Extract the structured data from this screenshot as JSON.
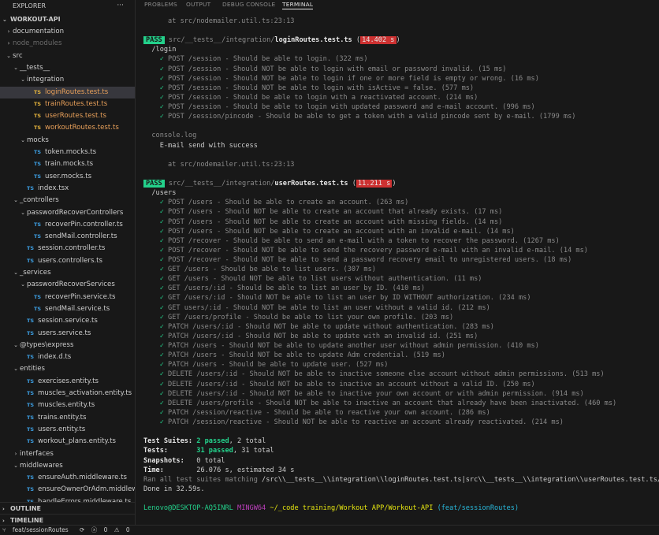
{
  "sidebar": {
    "title": "EXPLORER",
    "more": "···",
    "project": "WORKOUT-API",
    "outline": "OUTLINE",
    "timeline": "TIMELINE",
    "tree": [
      {
        "label": "documentation",
        "type": "folder",
        "open": false,
        "depth": 1
      },
      {
        "label": "node_modules",
        "type": "folder",
        "open": false,
        "depth": 1,
        "dim": true
      },
      {
        "label": "src",
        "type": "folder",
        "open": true,
        "depth": 1
      },
      {
        "label": "__tests__",
        "type": "folder",
        "open": true,
        "depth": 2
      },
      {
        "label": "integration",
        "type": "folder",
        "open": true,
        "depth": 3
      },
      {
        "label": "loginRoutes.test.ts",
        "type": "test",
        "depth": 4,
        "active": true
      },
      {
        "label": "trainRoutes.test.ts",
        "type": "test",
        "depth": 4
      },
      {
        "label": "userRoutes.test.ts",
        "type": "test",
        "depth": 4
      },
      {
        "label": "workoutRoutes.test.ts",
        "type": "test",
        "depth": 4
      },
      {
        "label": "mocks",
        "type": "folder",
        "open": true,
        "depth": 3
      },
      {
        "label": "token.mocks.ts",
        "type": "ts",
        "depth": 4
      },
      {
        "label": "train.mocks.ts",
        "type": "ts",
        "depth": 4
      },
      {
        "label": "user.mocks.ts",
        "type": "ts",
        "depth": 4
      },
      {
        "label": "index.tsx",
        "type": "ts",
        "depth": 3
      },
      {
        "label": "_controllers",
        "type": "folder",
        "open": true,
        "depth": 2
      },
      {
        "label": "passwordRecoverControllers",
        "type": "folder",
        "open": true,
        "depth": 3
      },
      {
        "label": "recoverPin.controller.ts",
        "type": "ts",
        "depth": 4
      },
      {
        "label": "sendMail.controller.ts",
        "type": "ts",
        "depth": 4
      },
      {
        "label": "session.controller.ts",
        "type": "ts",
        "depth": 3
      },
      {
        "label": "users.controllers.ts",
        "type": "ts",
        "depth": 3
      },
      {
        "label": "_services",
        "type": "folder",
        "open": true,
        "depth": 2
      },
      {
        "label": "passwordRecoverServices",
        "type": "folder",
        "open": true,
        "depth": 3
      },
      {
        "label": "recoverPin.service.ts",
        "type": "ts",
        "depth": 4
      },
      {
        "label": "sendMail.service.ts",
        "type": "ts",
        "depth": 4
      },
      {
        "label": "session.service.ts",
        "type": "ts",
        "depth": 3
      },
      {
        "label": "users.service.ts",
        "type": "ts",
        "depth": 3
      },
      {
        "label": "@types\\express",
        "type": "folder",
        "open": true,
        "depth": 2
      },
      {
        "label": "index.d.ts",
        "type": "ts",
        "depth": 3
      },
      {
        "label": "entities",
        "type": "folder",
        "open": true,
        "depth": 2
      },
      {
        "label": "exercises.entity.ts",
        "type": "ts",
        "depth": 3
      },
      {
        "label": "muscles_activation.entity.ts",
        "type": "ts",
        "depth": 3
      },
      {
        "label": "muscles.entity.ts",
        "type": "ts",
        "depth": 3
      },
      {
        "label": "trains.entity.ts",
        "type": "ts",
        "depth": 3
      },
      {
        "label": "users.entity.ts",
        "type": "ts",
        "depth": 3
      },
      {
        "label": "workout_plans.entity.ts",
        "type": "ts",
        "depth": 3
      },
      {
        "label": "interfaces",
        "type": "folder",
        "open": false,
        "depth": 2
      },
      {
        "label": "middlewares",
        "type": "folder",
        "open": true,
        "depth": 2
      },
      {
        "label": "ensureAuth.middleware.ts",
        "type": "ts",
        "depth": 3
      },
      {
        "label": "ensureOwnerOrAdm.middlewa...",
        "type": "ts",
        "depth": 3
      },
      {
        "label": "handleErrors.middleware.ts",
        "type": "ts",
        "depth": 3
      }
    ]
  },
  "panel": {
    "tabs": [
      {
        "label": "PROBLEMS",
        "active": false
      },
      {
        "label": "OUTPUT",
        "active": false
      },
      {
        "label": "DEBUG CONSOLE",
        "active": false
      },
      {
        "label": "TERMINAL",
        "active": true
      }
    ]
  },
  "terminal": {
    "lines": [
      {
        "kind": "at",
        "text": "      at src/nodemailer.util.ts:23:13"
      },
      {
        "kind": "blank"
      },
      {
        "kind": "suite",
        "badge": "PASS",
        "dir": "src/__tests__/integration/",
        "file": "loginRoutes.test.ts",
        "time": "14.402 s"
      },
      {
        "kind": "route",
        "text": "  /login"
      },
      {
        "kind": "test",
        "text": "POST /session - Should be able to login. (322 ms)"
      },
      {
        "kind": "test",
        "text": "POST /session - Should NOT be able to login with email or password invalid. (15 ms)"
      },
      {
        "kind": "test",
        "text": "POST /session - Should NOT be able to login if one or more field is empty or wrong. (16 ms)"
      },
      {
        "kind": "test",
        "text": "POST /session - Should NOT be able to login with isActive = false. (577 ms)"
      },
      {
        "kind": "test",
        "text": "POST /session - Should be able to login with a reactivated account. (214 ms)"
      },
      {
        "kind": "test",
        "text": "POST /session - Should be able to login with updated password and e-mail account. (996 ms)"
      },
      {
        "kind": "test",
        "text": "POST /session/pincode - Should be able to get a token with a valid pincode sent by e-mail. (1799 ms)"
      },
      {
        "kind": "blank"
      },
      {
        "kind": "console",
        "text": "  console.log"
      },
      {
        "kind": "plain",
        "text": "    E-mail send with success"
      },
      {
        "kind": "blank"
      },
      {
        "kind": "at",
        "text": "      at src/nodemailer.util.ts:23:13"
      },
      {
        "kind": "blank"
      },
      {
        "kind": "suite",
        "badge": "PASS",
        "dir": "src/__tests__/integration/",
        "file": "userRoutes.test.ts",
        "time": "11.211 s"
      },
      {
        "kind": "route",
        "text": "  /users"
      },
      {
        "kind": "test",
        "text": "POST /users - Should be able to create an account. (263 ms)"
      },
      {
        "kind": "test",
        "text": "POST /users - Should NOT be able to create an account that already exists. (17 ms)"
      },
      {
        "kind": "test",
        "text": "POST /users - Should NOT be able to create an account with missing fields. (14 ms)"
      },
      {
        "kind": "test",
        "text": "POST /users - Should NOT be able to create an account with an invalid e-mail. (14 ms)"
      },
      {
        "kind": "test",
        "text": "POST /recover - Should be able to send an e-mail with a token to recover the password. (1267 ms)"
      },
      {
        "kind": "test",
        "text": "POST /recover - Should NOT be able to send the recovery password e-mail with an invalid e-mail. (14 ms)"
      },
      {
        "kind": "test",
        "text": "POST /recover - Should NOT be able to send a password recovery email to unregistered users. (18 ms)"
      },
      {
        "kind": "test",
        "text": "GET /users - Should be able to list users. (307 ms)"
      },
      {
        "kind": "test",
        "text": "GET /users - Should NOT be able to list users without authentication. (11 ms)"
      },
      {
        "kind": "test",
        "text": "GET /users/:id - Should be able to list an user by ID. (410 ms)"
      },
      {
        "kind": "test",
        "text": "GET /users/:id - Should NOT be able to list an user by ID WITHOUT authorization. (234 ms)"
      },
      {
        "kind": "test",
        "text": "GET users/:id - Should NOT be able to list an user without a valid id. (212 ms)"
      },
      {
        "kind": "test",
        "text": "GET /users/profile - Should be able to list your own profile. (203 ms)"
      },
      {
        "kind": "test",
        "text": "PATCH /users/:id - Should NOT be able to update without authentication. (283 ms)"
      },
      {
        "kind": "test",
        "text": "PATCH /users/:id - Should NOT be able to update with an invalid id. (251 ms)"
      },
      {
        "kind": "test",
        "text": "PATCH /users - Should NOT be able to update another user without admin permission. (410 ms)"
      },
      {
        "kind": "test",
        "text": "PATCH /users - Should NOT be able to update Adm credential. (519 ms)"
      },
      {
        "kind": "test",
        "text": "PATCH /users - Should be able to update user. (527 ms)"
      },
      {
        "kind": "test",
        "text": "DELETE /users/:id - Should NOT be able to inactive someone else account without admin permissions. (513 ms)"
      },
      {
        "kind": "test",
        "text": "DELETE /users/:id - Should NOT be able to inactive an account without a valid ID. (250 ms)"
      },
      {
        "kind": "test",
        "text": "DELETE /users/:id - Should NOT be able to inactive your own account or with admin permission. (914 ms)"
      },
      {
        "kind": "test",
        "text": "DELETE /users/profile - Should NOT be able to inactive an account that already have been inactivated. (460 ms)"
      },
      {
        "kind": "test",
        "text": "PATCH /session/reactive - Should be able to reactive your own account. (286 ms)"
      },
      {
        "kind": "test",
        "text": "PATCH /session/reactive - Should NOT be able to reactive an account already reactivated. (214 ms)"
      },
      {
        "kind": "blank"
      },
      {
        "kind": "summary",
        "label": "Test Suites: ",
        "value": "2 passed",
        "rest": ", 2 total"
      },
      {
        "kind": "summary",
        "label": "Tests:       ",
        "value": "31 passed",
        "rest": ", 31 total"
      },
      {
        "kind": "summary",
        "label": "Snapshots:   ",
        "value": "",
        "rest": "0 total"
      },
      {
        "kind": "summary",
        "label": "Time:        ",
        "value": "",
        "rest": "26.076 s, estimated 34 s"
      },
      {
        "kind": "ranall",
        "pre": "Ran all test suites matching ",
        "path": "/src\\\\__tests__\\\\integration\\\\loginRoutes.test.ts|src\\\\__tests__\\\\integration\\\\userRoutes.test.ts/i",
        "post": "."
      },
      {
        "kind": "plain",
        "text": "Done in 32.59s."
      },
      {
        "kind": "blank"
      },
      {
        "kind": "prompt",
        "user": "Lenovo@DESKTOP-AQ5INRL",
        "shell": "MINGW64",
        "path": "~/_code training/Workout APP/Workout-API",
        "branch": "(feat/sessionRoutes)"
      }
    ]
  },
  "statusbar": {
    "branch": "feat/sessionRoutes",
    "sync": "⟳",
    "errors": "0",
    "warnings": "0"
  }
}
